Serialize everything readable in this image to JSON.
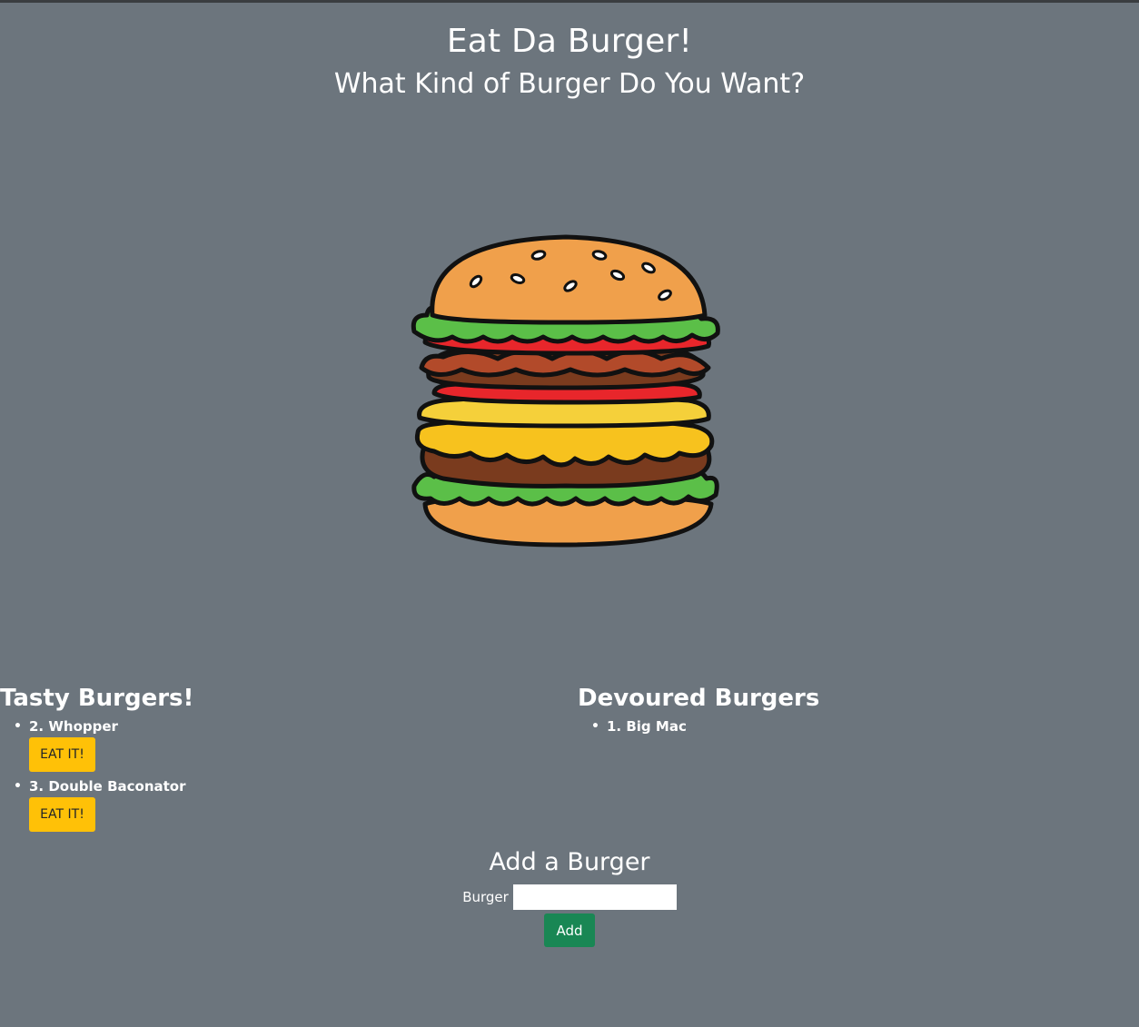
{
  "header": {
    "title": "Eat Da Burger!",
    "subtitle": "What Kind of Burger Do You Want?"
  },
  "image": {
    "icon": "burger-illustration"
  },
  "tasty": {
    "heading": "Tasty Burgers!",
    "items": [
      {
        "label": "2. Whopper",
        "button": "EAT IT!"
      },
      {
        "label": "3. Double Baconator",
        "button": "EAT IT!"
      }
    ]
  },
  "devoured": {
    "heading": "Devoured Burgers",
    "items": [
      {
        "label": "1. Big Mac"
      }
    ]
  },
  "add_form": {
    "heading": "Add a Burger",
    "label": "Burger",
    "input_value": "",
    "button": "Add"
  },
  "colors": {
    "background": "#6c757d",
    "eat_button": "#ffc107",
    "add_button": "#198754"
  }
}
